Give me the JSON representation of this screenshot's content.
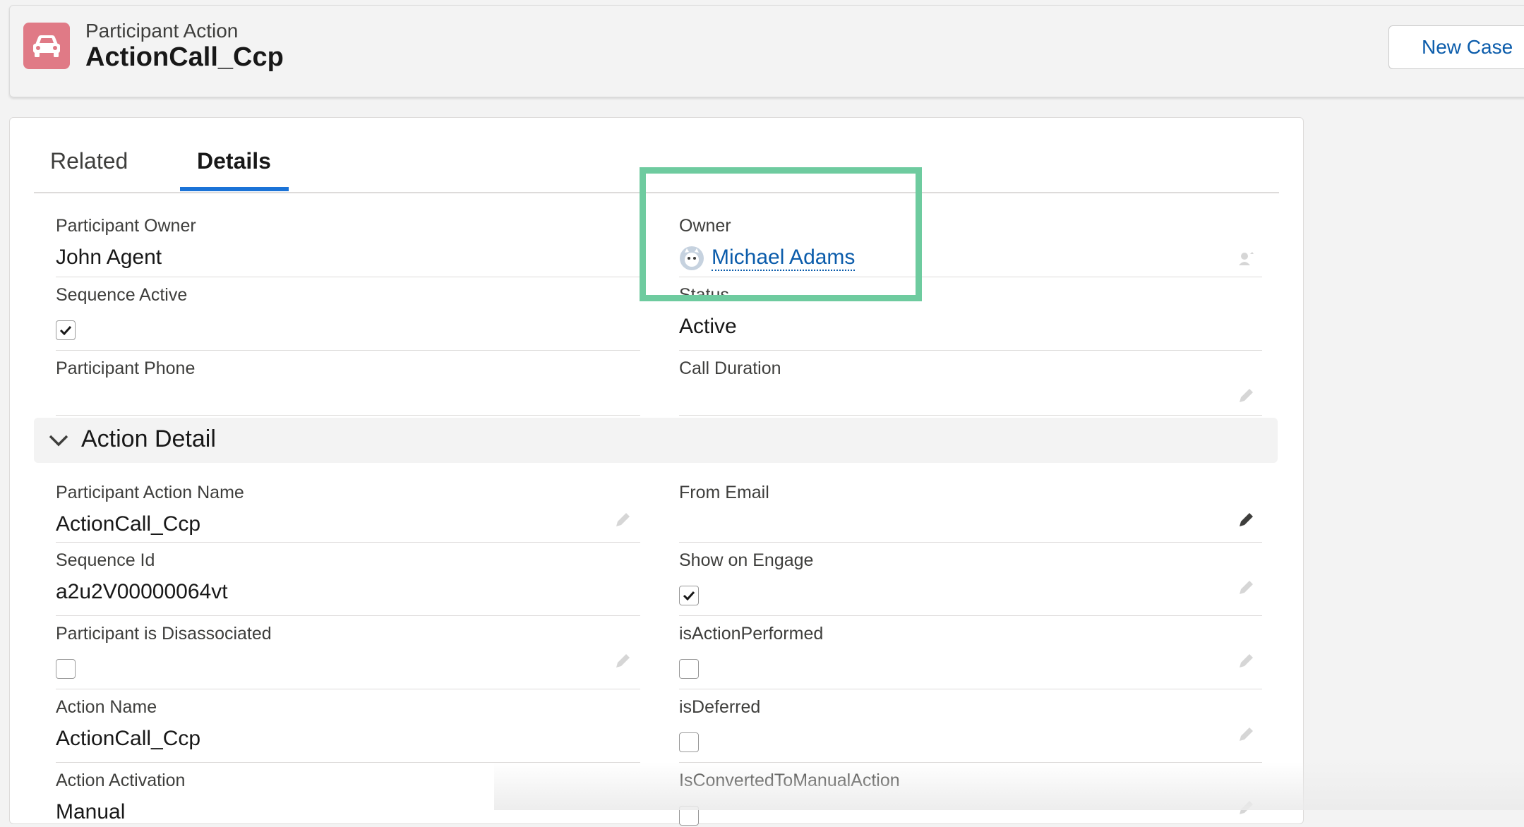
{
  "header": {
    "object_label": "Participant Action",
    "record_title": "ActionCall_Ccp",
    "new_case_button": "New Case",
    "icon": "car-icon"
  },
  "tabs": [
    {
      "label": "Related",
      "active": false
    },
    {
      "label": "Details",
      "active": true
    }
  ],
  "fields_top": {
    "participant_owner": {
      "label": "Participant Owner",
      "value": "John Agent"
    },
    "owner": {
      "label": "Owner",
      "value": "Michael Adams",
      "icon": "user-avatar-icon"
    },
    "sequence_active": {
      "label": "Sequence Active",
      "checked": true
    },
    "status": {
      "label": "Status",
      "value": "Active"
    },
    "participant_phone": {
      "label": "Participant Phone",
      "value": ""
    },
    "call_duration": {
      "label": "Call Duration",
      "value": ""
    }
  },
  "section": {
    "title": "Action Detail",
    "icon": "chevron-down-icon"
  },
  "fields_detail": {
    "participant_action_name": {
      "label": "Participant Action Name",
      "value": "ActionCall_Ccp"
    },
    "from_email": {
      "label": "From Email",
      "value": ""
    },
    "sequence_id": {
      "label": "Sequence Id",
      "value": "a2u2V00000064vt"
    },
    "show_on_engage": {
      "label": "Show on Engage",
      "checked": true
    },
    "participant_disassociated": {
      "label": "Participant is Disassociated",
      "checked": false
    },
    "is_action_performed": {
      "label": "isActionPerformed",
      "checked": false
    },
    "action_name": {
      "label": "Action Name",
      "value": "ActionCall_Ccp"
    },
    "is_deferred": {
      "label": "isDeferred",
      "checked": false
    },
    "action_activation": {
      "label": "Action Activation",
      "value": "Manual"
    },
    "is_converted_manual": {
      "label": "IsConvertedToManualAction",
      "checked": false
    }
  },
  "colors": {
    "brand_blue": "#0b5cab",
    "tab_underline": "#1b73d7",
    "object_icon_bg": "#e07a86",
    "highlight": "#6ecb9f"
  }
}
